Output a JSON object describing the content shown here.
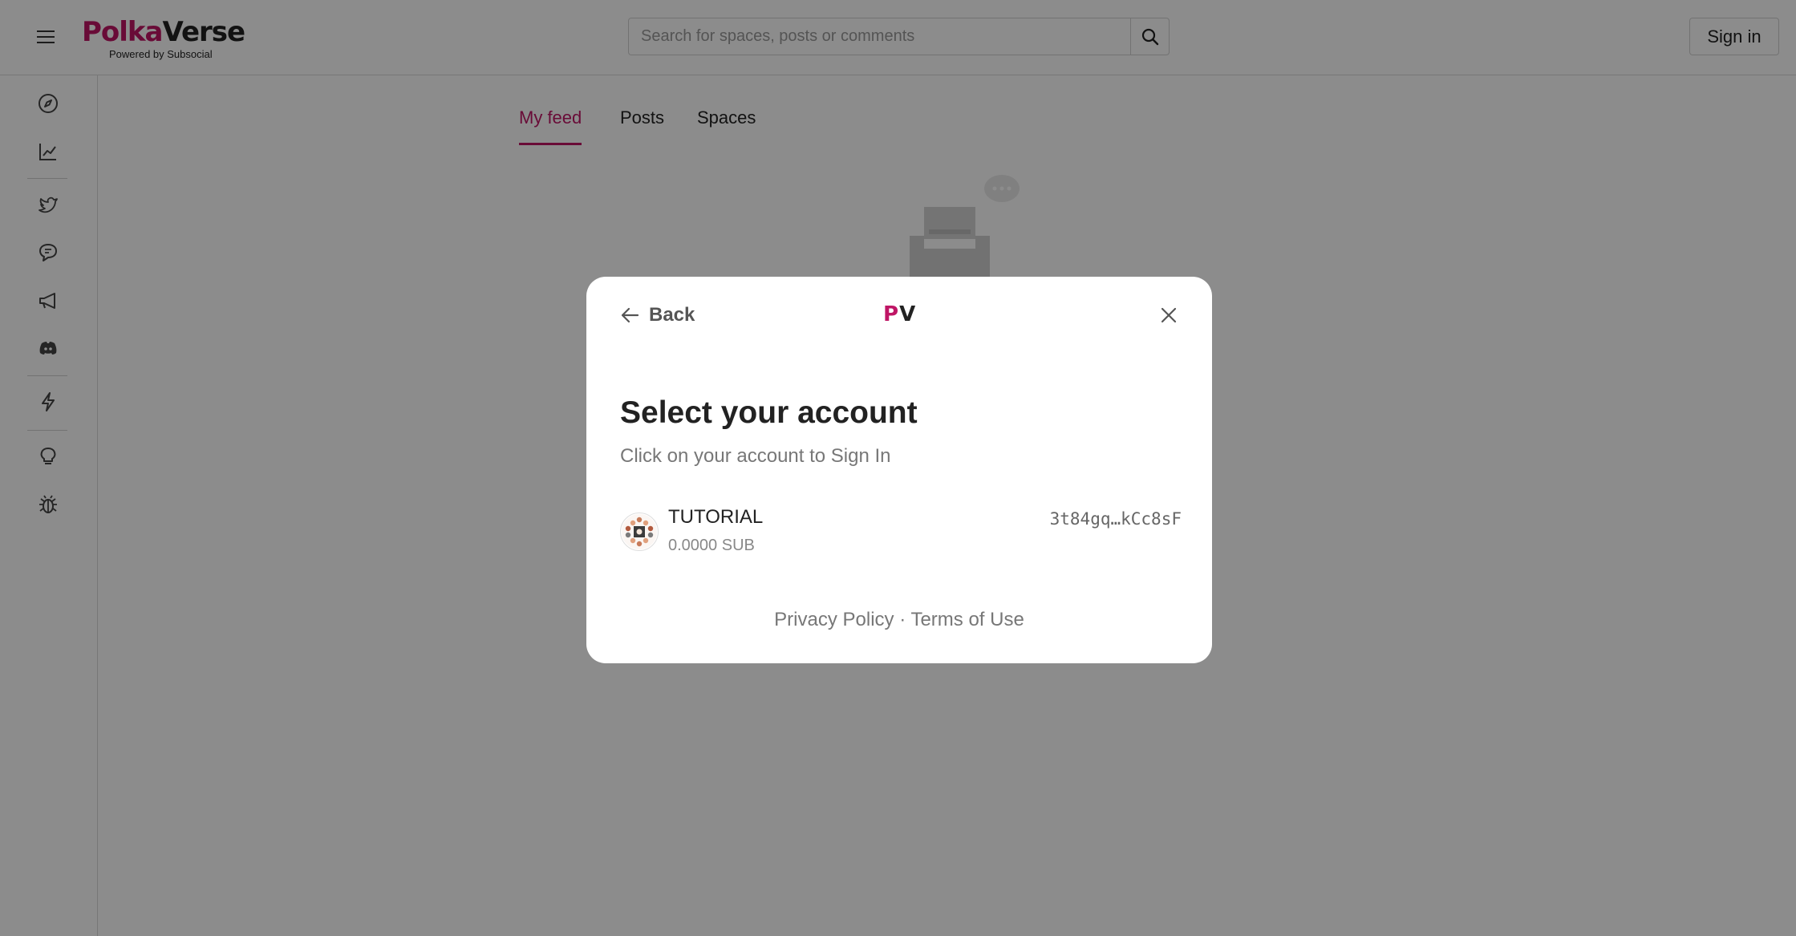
{
  "header": {
    "logo_part1": "Polka",
    "logo_part2": "Verse",
    "logo_tagline": "Powered by Subsocial",
    "search_placeholder": "Search for spaces, posts or comments",
    "signin_label": "Sign in"
  },
  "sidebar": {
    "icons": [
      "compass-icon",
      "chart-icon",
      "twitter-icon",
      "chat-icon",
      "megaphone-icon",
      "discord-icon",
      "lightning-icon",
      "lightbulb-icon",
      "bug-icon"
    ]
  },
  "tabs": [
    {
      "label": "My feed",
      "active": true
    },
    {
      "label": "Posts",
      "active": false
    },
    {
      "label": "Spaces",
      "active": false
    }
  ],
  "modal": {
    "back_label": "Back",
    "logo_part1": "P",
    "logo_part2": "V",
    "title": "Select your account",
    "subtitle": "Click on your account to Sign In",
    "account": {
      "name": "TUTORIAL",
      "balance": "0.0000 SUB",
      "address": "3t84gq…kCc8sF"
    },
    "privacy_label": "Privacy Policy",
    "separator": "·",
    "terms_label": "Terms of Use"
  },
  "colors": {
    "accent": "#bf1565",
    "overlay": "rgba(0,0,0,0.45)"
  }
}
